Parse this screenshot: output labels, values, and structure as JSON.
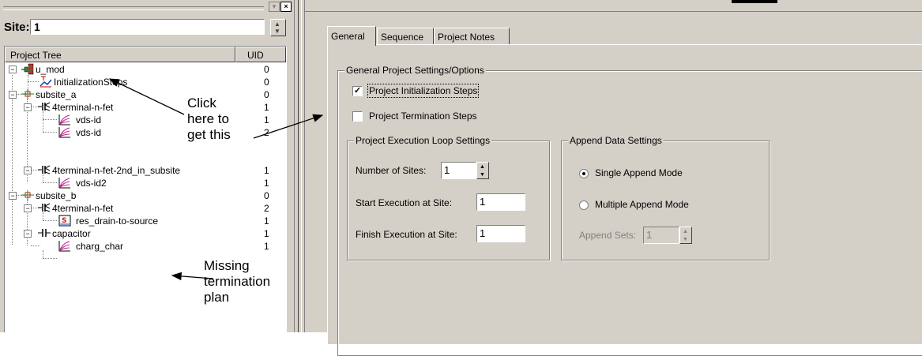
{
  "site": {
    "label": "Site:",
    "value": "1"
  },
  "tree": {
    "header": {
      "tree_col": "Project Tree",
      "uid_col": "UID"
    },
    "rows": [
      {
        "label": "u_mod",
        "uid": "0"
      },
      {
        "label": "InitializationSteps",
        "uid": "0"
      },
      {
        "label": "subsite_a",
        "uid": "0"
      },
      {
        "label": "4terminal-n-fet",
        "uid": "1"
      },
      {
        "label": "vds-id",
        "uid": "1"
      },
      {
        "label": "vds-id",
        "uid": "2"
      },
      {
        "label": "4terminal-n-fet-2nd_in_subsite",
        "uid": "1"
      },
      {
        "label": "vds-id2",
        "uid": "1"
      },
      {
        "label": "subsite_b",
        "uid": "0"
      },
      {
        "label": "4terminal-n-fet",
        "uid": "2"
      },
      {
        "label": "res_drain-to-source",
        "uid": "1"
      },
      {
        "label": "capacitor",
        "uid": "1"
      },
      {
        "label": "charg_char",
        "uid": "1"
      }
    ]
  },
  "annotations": {
    "click": [
      "Click",
      "here to",
      "get this"
    ],
    "missing": [
      "Missing",
      "termination",
      "plan"
    ]
  },
  "tabs": [
    {
      "label": "General",
      "active": true
    },
    {
      "label": "Sequence",
      "active": false
    },
    {
      "label": "Project Notes",
      "active": false
    }
  ],
  "general": {
    "group_title": "General Project Settings/Options",
    "init_steps": {
      "label": "Project Initialization Steps",
      "checked": true
    },
    "term_steps": {
      "label": "Project Termination Steps",
      "checked": false
    }
  },
  "loop": {
    "group_title": "Project Execution Loop Settings",
    "num_sites": {
      "label": "Number of Sites:",
      "value": "1"
    },
    "start_site": {
      "label": "Start Execution at Site:",
      "value": "1"
    },
    "finish_site": {
      "label": "Finish Execution at Site:",
      "value": "1"
    }
  },
  "append": {
    "group_title": "Append Data Settings",
    "single": {
      "label": "Single Append Mode",
      "selected": true
    },
    "multiple": {
      "label": "Multiple Append Mode",
      "selected": false
    },
    "sets": {
      "label": "Append Sets:",
      "value": "1"
    }
  },
  "colors": {
    "face": "#d4d0c8",
    "shadow": "#808080",
    "highlight": "#ffffff",
    "disabled_text": "#808080"
  },
  "icons": [
    "module-icon",
    "init-steps-icon",
    "subsite-icon",
    "fet-icon",
    "chart-icon",
    "resistor-icon",
    "capacitor-icon",
    "checkbox-check",
    "spinner-arrows"
  ]
}
